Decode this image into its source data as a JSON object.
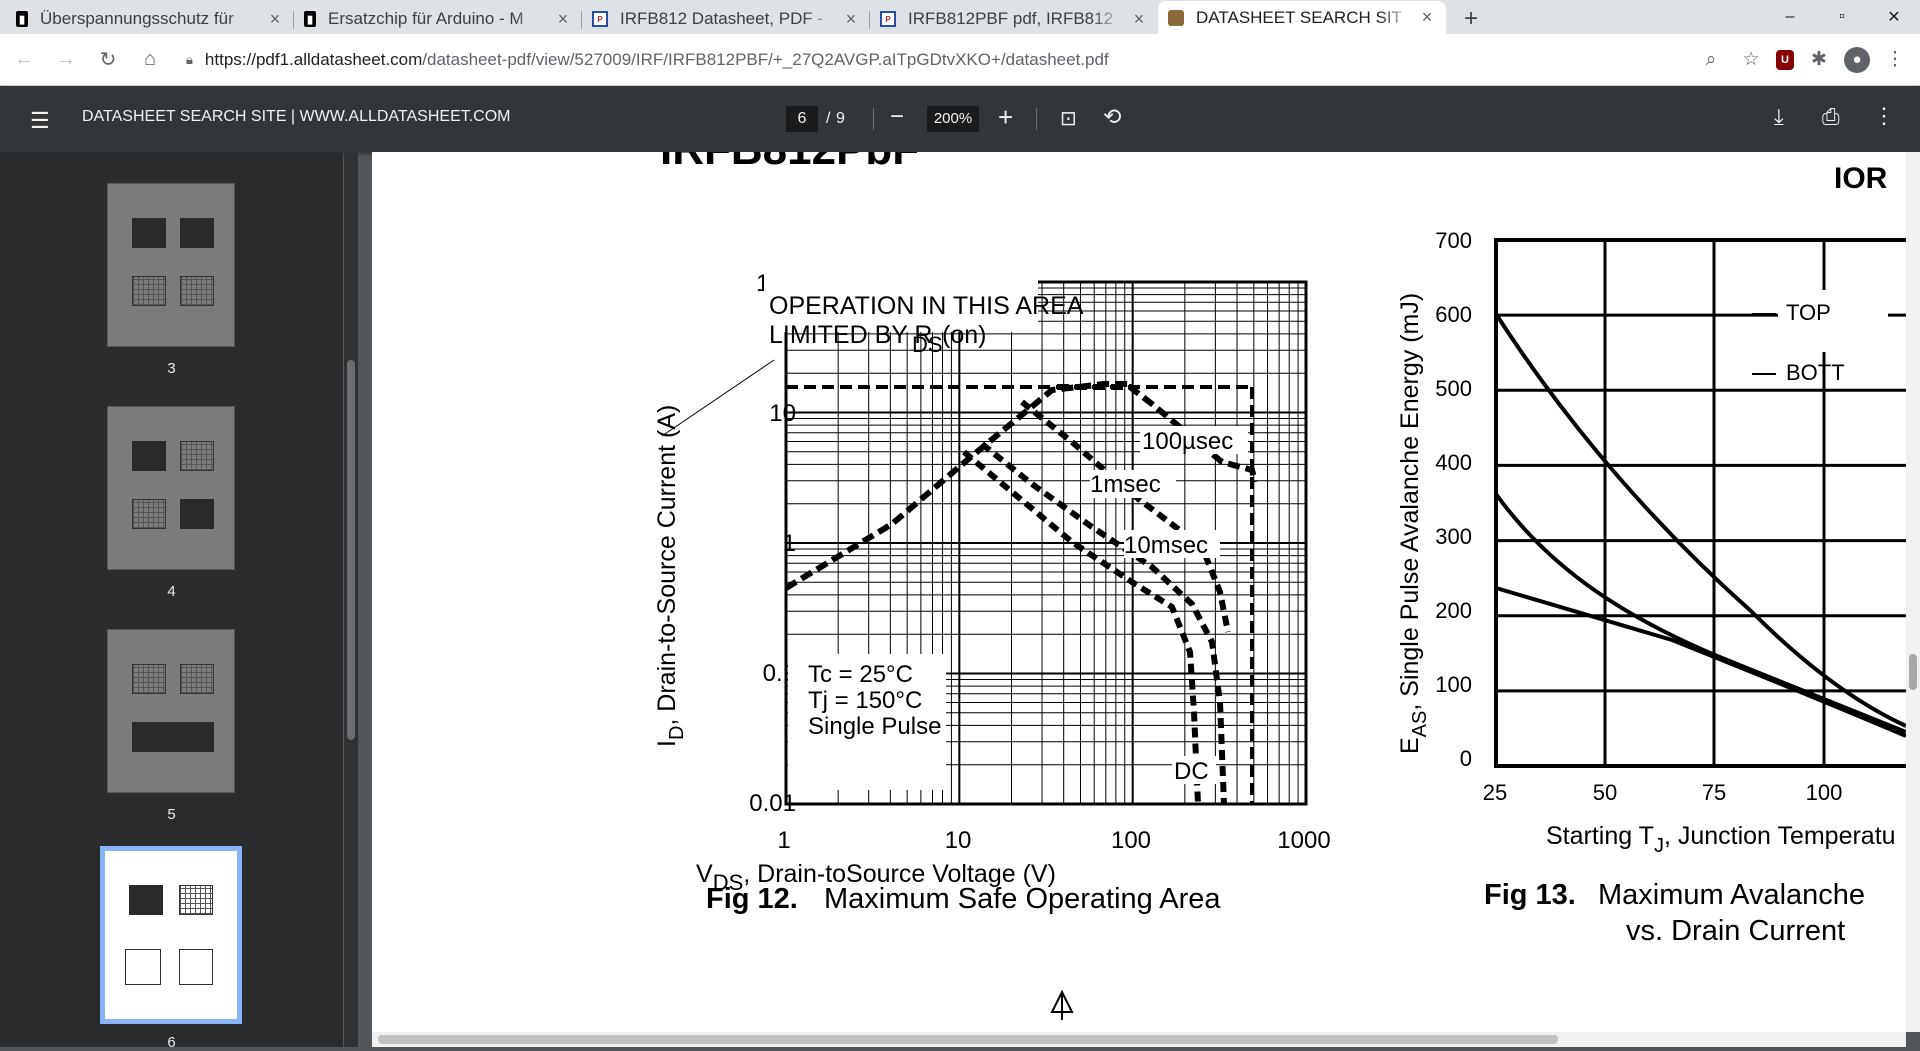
{
  "browser": {
    "tabs": [
      {
        "title": "Überspannungsschutz für",
        "icon": "arduino-icon"
      },
      {
        "title": "Ersatzchip für Arduino - M",
        "icon": "arduino-icon"
      },
      {
        "title": "IRFB812 Datasheet, PDF -",
        "icon": "pdf-icon"
      },
      {
        "title": "IRFB812PBF pdf, IRFB812",
        "icon": "pdf-icon"
      },
      {
        "title": "DATASHEET SEARCH SIT",
        "icon": "chip-icon",
        "active": true
      }
    ],
    "url_host": "https://pdf1.alldatasheet.com",
    "url_path": "/datasheet-pdf/view/527009/IRF/IRFB812PBF/+_27Q2AVGP.aITpGDtvXKO+/datasheet.pdf"
  },
  "viewer": {
    "title": "DATASHEET SEARCH SITE | WWW.ALLDATASHEET.COM",
    "page_current": "6",
    "page_sep": "/",
    "page_total": "9",
    "zoom": "200%"
  },
  "thumbnails": [
    {
      "label": "3"
    },
    {
      "label": "4"
    },
    {
      "label": "5"
    },
    {
      "label": "6",
      "selected": true
    }
  ],
  "document": {
    "header_partial": "IRFB812PbF",
    "logo": "IOR",
    "fig12": {
      "caption_num": "Fig 12.",
      "caption_text": "Maximum Safe Operating Area",
      "ylabel_main": "I",
      "ylabel_sub": "D",
      "ylabel_rest": ",  Drain-to-Source Current (A)",
      "xlabel_main": "V",
      "xlabel_sub": "DS",
      "xlabel_rest": ",  Drain-toSource Voltage (V)",
      "x_ticks": [
        "1",
        "10",
        "100",
        "1000"
      ],
      "y_ticks": [
        "100",
        "10",
        "1",
        "0.1",
        "0.01"
      ],
      "annotation_line1": "OPERATION IN THIS AREA",
      "annotation_line2": "LIMITED BY R",
      "annotation_sub": "DS",
      "annotation_suffix": "(on)",
      "curve_labels": [
        "100µsec",
        "1msec",
        "10msec",
        "DC"
      ],
      "conditions": [
        "Tc = 25°C",
        "Tj = 150°C",
        "Single Pulse"
      ]
    },
    "fig13": {
      "caption_num": "Fig 13.",
      "caption_line1": "Maximum Avalanche",
      "caption_line2": "vs. Drain Current",
      "ylabel_main": "E",
      "ylabel_sub": "AS",
      "ylabel_rest": ",  Single Pulse Avalanche Energy (mJ)",
      "xlabel_main": "Starting T",
      "xlabel_sub": "J",
      "xlabel_rest": ",  Junction Temperatu",
      "x_ticks": [
        "25",
        "50",
        "75",
        "100"
      ],
      "y_ticks": [
        "700",
        "600",
        "500",
        "400",
        "300",
        "200",
        "100",
        "0"
      ],
      "legend": [
        "TOP",
        "BOTT"
      ]
    }
  }
}
